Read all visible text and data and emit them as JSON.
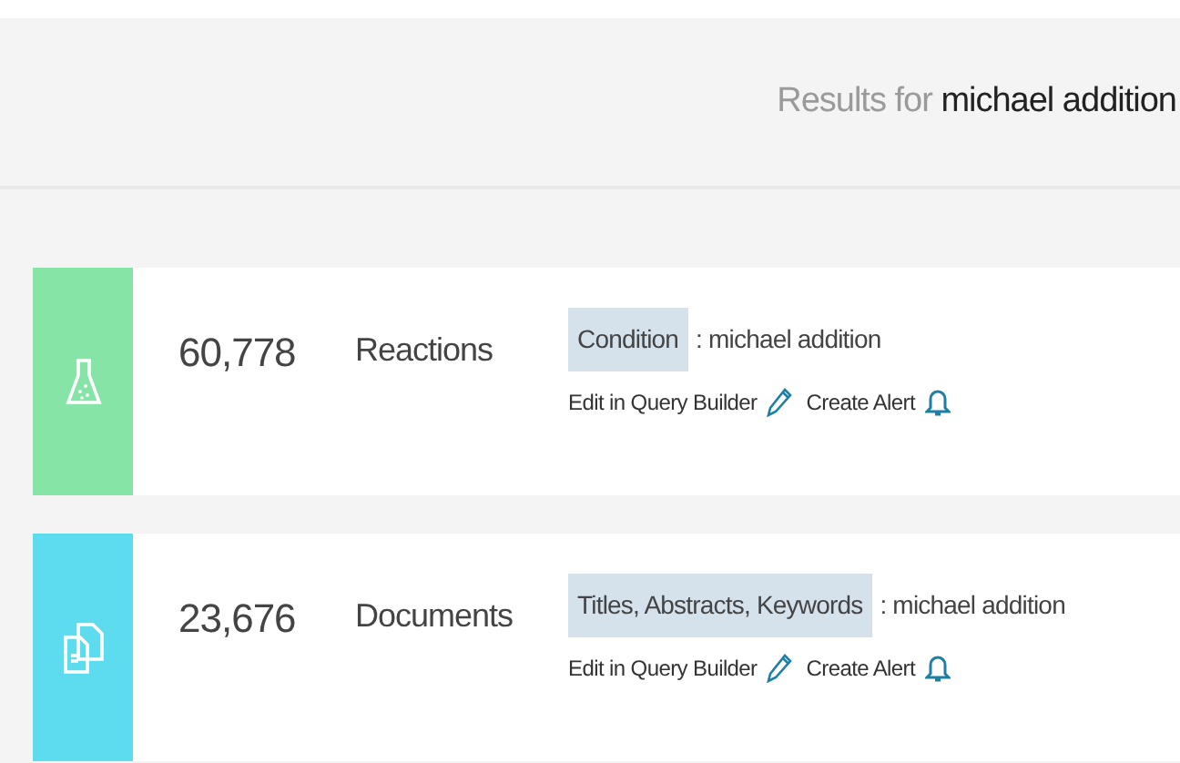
{
  "header": {
    "title": "Results for **michael addition**"
  },
  "results": [
    {
      "kind": "reactions",
      "color": "#86e5a6",
      "count": "60,778",
      "label": "Reactions",
      "field": "Condition",
      "query": ": michael addition",
      "actions": [
        {
          "kind": "edit",
          "label": "Edit in Query Builder"
        },
        {
          "kind": "alert",
          "label": "Create Alert"
        }
      ]
    },
    {
      "kind": "documents",
      "color": "#5ddcf0",
      "count": "23,676",
      "label": "Documents",
      "field": "Titles, Abstracts, Keywords",
      "query": ": michael addition",
      "actions": [
        {
          "kind": "edit",
          "label": "Edit in Query Builder"
        },
        {
          "kind": "alert",
          "label": "Create Alert"
        }
      ]
    }
  ]
}
